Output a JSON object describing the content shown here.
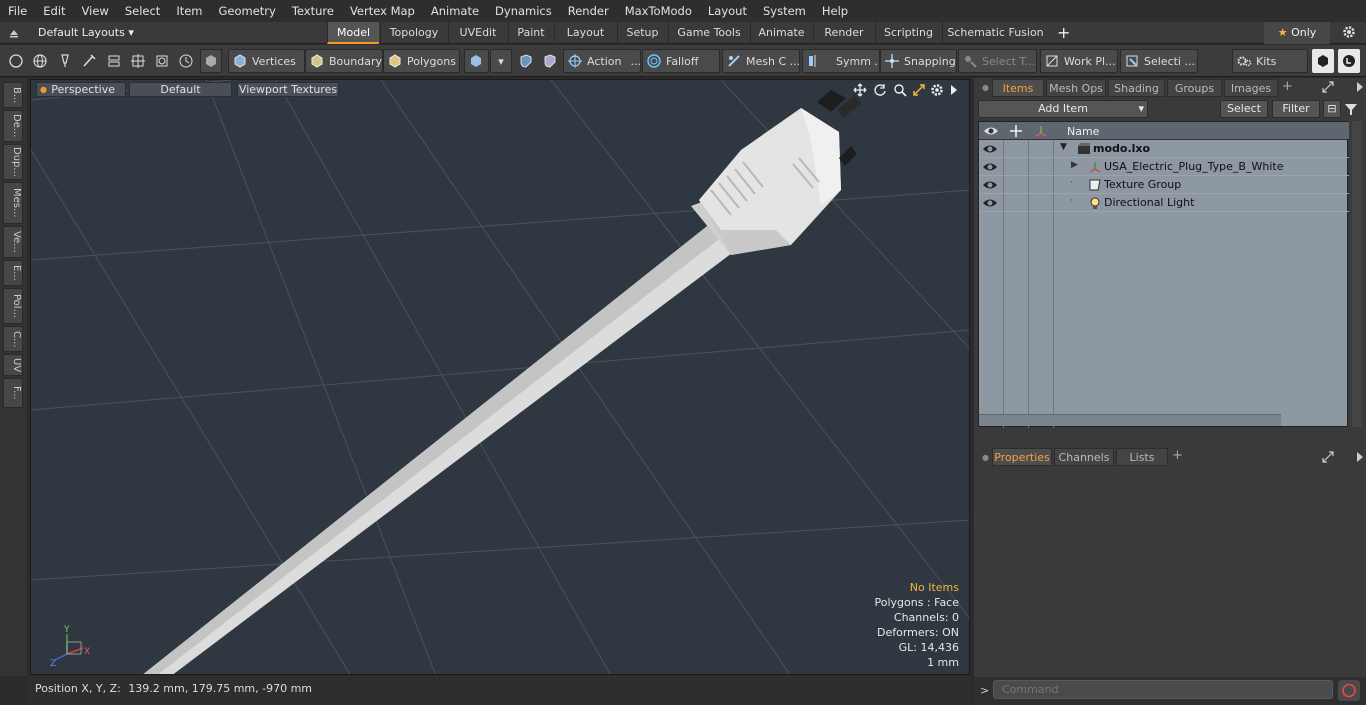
{
  "menu": [
    "File",
    "Edit",
    "View",
    "Select",
    "Item",
    "Geometry",
    "Texture",
    "Vertex Map",
    "Animate",
    "Dynamics",
    "Render",
    "MaxToModo",
    "Layout",
    "System",
    "Help"
  ],
  "layouts": {
    "selector": "Default Layouts",
    "tabs": [
      "Model",
      "Topology",
      "UVEdit",
      "Paint",
      "Layout",
      "Setup",
      "Game Tools",
      "Animate",
      "Render",
      "Scripting",
      "Schematic Fusion"
    ],
    "active": "Model",
    "only_label": "Only"
  },
  "toolbar": {
    "vertices": "Vertices",
    "boundary": "Boundary",
    "polygons": "Polygons",
    "action": "Action",
    "action_more": "...",
    "falloff": "Falloff",
    "mesh": "Mesh C ...",
    "symm": "Symm ...",
    "snapping": "Snapping",
    "select_t": "Select T...",
    "work_pl": "Work Pl...",
    "selecti": "Selecti ...",
    "kits": "Kits"
  },
  "left_tabs": [
    "B...",
    "De...",
    "Dup...",
    "Mes...",
    "Ve...",
    "E...",
    "Pol...",
    "C...",
    "UV",
    "F..."
  ],
  "viewport": {
    "view": "Perspective",
    "shading": "Default",
    "textures": "Viewport Textures",
    "stats": {
      "no_items": "No Items",
      "polygons": "Polygons : Face",
      "channels": "Channels: 0",
      "deformers": "Deformers: ON",
      "gl": "GL: 14,436",
      "unit": "1 mm"
    },
    "axis": {
      "x": "X",
      "y": "Y",
      "z": "Z"
    }
  },
  "status": {
    "label": "Position X, Y, Z:",
    "value": "139.2 mm, 179.75 mm, -970 mm"
  },
  "items_panel": {
    "tabs": [
      "Items",
      "Mesh Ops",
      "Shading",
      "Groups",
      "Images"
    ],
    "active": "Items",
    "add_item": "Add Item",
    "select": "Select",
    "filter": "Filter",
    "name_header": "Name",
    "rows": [
      {
        "label": "modo.lxo",
        "bold": true
      },
      {
        "label": "USA_Electric_Plug_Type_B_White",
        "bold": false
      },
      {
        "label": "Texture Group",
        "bold": false
      },
      {
        "label": "Directional Light",
        "bold": false
      }
    ]
  },
  "props_panel": {
    "tabs": [
      "Properties",
      "Channels",
      "Lists"
    ],
    "active": "Properties"
  },
  "command": {
    "placeholder": "Command",
    "prompt": ">"
  },
  "colors": {
    "accent": "#f39a2b",
    "viewport_bg": "#2f3840",
    "list_bg": "#8d98a2"
  }
}
